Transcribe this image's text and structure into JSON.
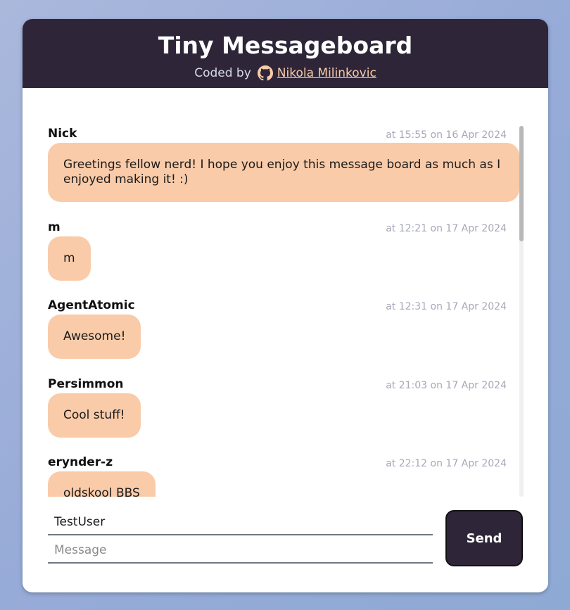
{
  "header": {
    "title": "Tiny Messageboard",
    "coded_by": "Coded by",
    "author_link": "Nikola Milinkovic",
    "github_icon": "github-icon"
  },
  "messages": [
    {
      "author": "Nick",
      "time": "at 15:55 on 16 Apr 2024",
      "text": "Greetings fellow nerd! I hope you enjoy this message board as much as I enjoyed making it! :)"
    },
    {
      "author": "m",
      "time": "at 12:21 on 17 Apr 2024",
      "text": "m"
    },
    {
      "author": "AgentAtomic",
      "time": "at 12:31 on 17 Apr 2024",
      "text": "Awesome!"
    },
    {
      "author": "Persimmon",
      "time": "at 21:03 on 17 Apr 2024",
      "text": "Cool stuff!"
    },
    {
      "author": "erynder-z",
      "time": "at 22:12 on 17 Apr 2024",
      "text": "oldskool BBS"
    }
  ],
  "form": {
    "username_value": "TestUser",
    "message_placeholder": "Message",
    "send_label": "Send"
  },
  "colors": {
    "header_bg": "#2e2638",
    "bubble_bg": "#f9cba9",
    "accent": "#f9cba9"
  }
}
